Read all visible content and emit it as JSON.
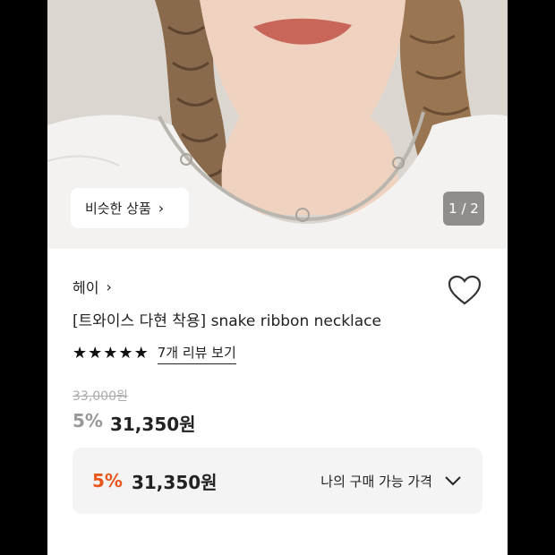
{
  "hero": {
    "similar_button_label": "비슷한 상품",
    "pager": "1 / 2"
  },
  "product": {
    "brand": "헤이",
    "title": "[트와이스 다현 착용] snake ribbon necklace",
    "rating_stars": 5,
    "review_link": "7개 리뷰 보기",
    "original_price": "33,000원",
    "discount_percent": "5%",
    "sale_price": "31,350원"
  },
  "my_price": {
    "discount_percent": "5%",
    "price": "31,350원",
    "label": "나의 구매 가능 가격"
  },
  "colors": {
    "accent_discount": "#e8561c",
    "box_background": "#f4f4f4"
  },
  "icons": [
    "chevron-right-icon",
    "heart-icon",
    "star-icon",
    "chevron-down-icon"
  ]
}
